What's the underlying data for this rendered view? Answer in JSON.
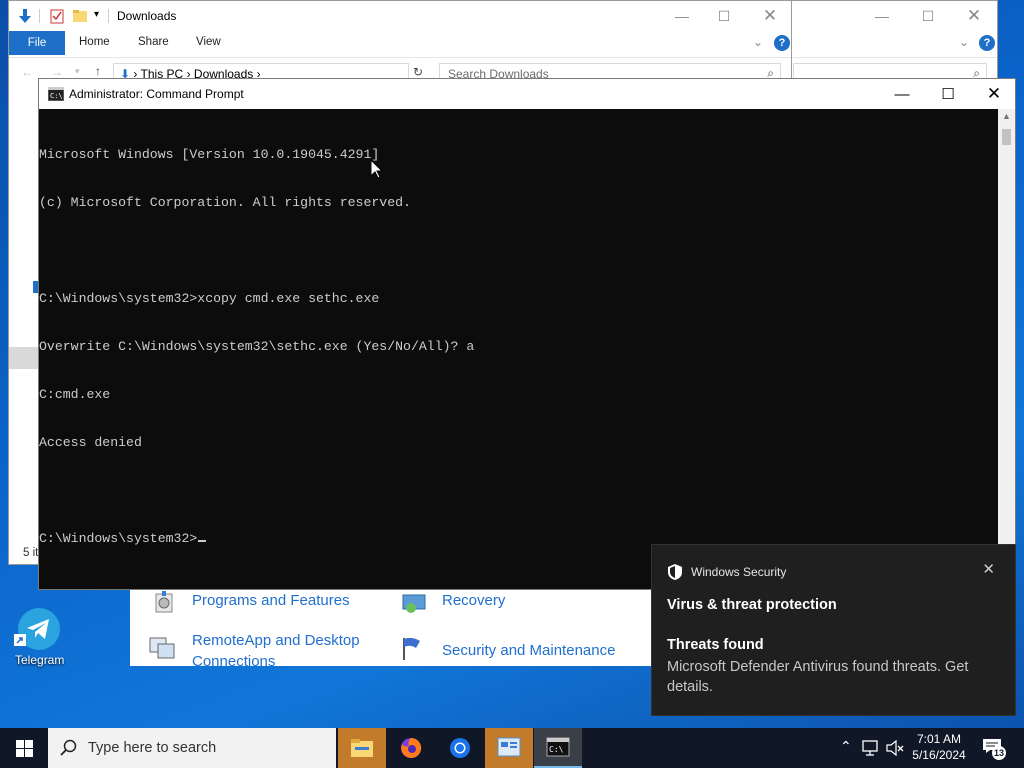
{
  "explorer": {
    "title": "Downloads",
    "tabs": {
      "file": "File",
      "home": "Home",
      "share": "Share",
      "view": "View"
    },
    "address": {
      "this_pc": "This PC",
      "downloads": "Downloads"
    },
    "search_placeholder": "Search Downloads",
    "status_partial": "5 it"
  },
  "control_panel": {
    "items": [
      {
        "label": "Programs and Features"
      },
      {
        "label": "Recovery"
      },
      {
        "label": "RemoteApp and Desktop Connections"
      },
      {
        "label": "Security and Maintenance"
      }
    ]
  },
  "cmd": {
    "title": "Administrator: Command Prompt",
    "lines": [
      "Microsoft Windows [Version 10.0.19045.4291]",
      "(c) Microsoft Corporation. All rights reserved.",
      "",
      "C:\\Windows\\system32>xcopy cmd.exe sethc.exe",
      "Overwrite C:\\Windows\\system32\\sethc.exe (Yes/No/All)? a",
      "C:cmd.exe",
      "Access denied",
      "",
      "C:\\Windows\\system32>"
    ]
  },
  "desktop": {
    "icons": [
      {
        "label": "Telegram",
        "icon": "telegram-icon"
      }
    ]
  },
  "notification": {
    "app": "Windows Security",
    "heading": "Virus & threat protection",
    "subheading": "Threats found",
    "body": "Microsoft Defender Antivirus found threats. Get details."
  },
  "taskbar": {
    "search_placeholder": "Type here to search",
    "apps": [
      "file-explorer-icon",
      "firefox-icon",
      "chrome-icon",
      "control-panel-icon",
      "command-prompt-icon"
    ],
    "clock": {
      "time": "7:01 AM",
      "date": "5/16/2024"
    },
    "notification_count": "13"
  },
  "colors": {
    "file_tab": "#1e6fc7",
    "console_bg": "#0c0c0c",
    "console_fg": "#cccccc",
    "link_blue": "#1f6fcf",
    "toast_bg": "#1f1f1f",
    "taskbar_bg": "#101827"
  }
}
